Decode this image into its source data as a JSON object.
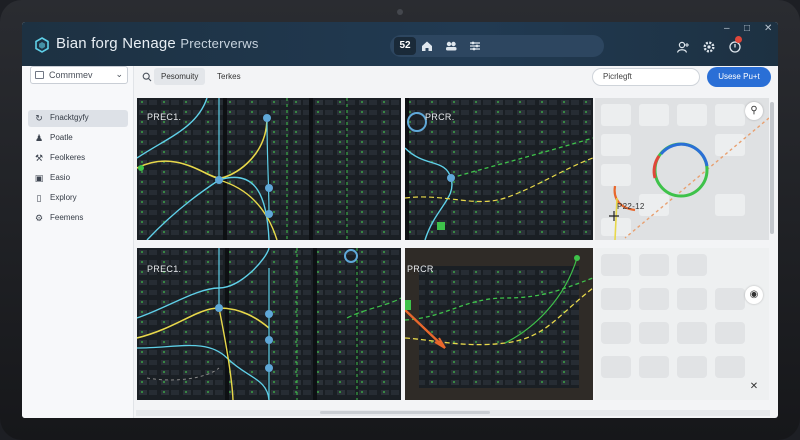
{
  "app": {
    "title": "Bian forg Nenage",
    "subtitle": "Precterverws",
    "pill_badge": "52",
    "colors": {
      "titlebar": "#213a52",
      "accent": "#2a6fd6",
      "cyan": "#5fd0e8",
      "yellow": "#e8d84a",
      "green": "#3ec24a",
      "orange": "#e8672c"
    }
  },
  "window_controls": [
    "minimize",
    "maximize",
    "close"
  ],
  "header_icons": [
    "user-icon",
    "gear-icon",
    "notification-icon"
  ],
  "sidebar": {
    "select_label": "Commmev",
    "items": [
      {
        "label": "Fnacktgyfy",
        "icon": "reload-icon",
        "active": true
      },
      {
        "label": "Poatle",
        "icon": "users-icon",
        "active": false
      },
      {
        "label": "Feolkeres",
        "icon": "tools-icon",
        "active": false
      },
      {
        "label": "Easio",
        "icon": "window-icon",
        "active": false
      },
      {
        "label": "Explory",
        "icon": "bell-icon",
        "active": false
      },
      {
        "label": "Feemens",
        "icon": "gear-icon",
        "active": false
      }
    ]
  },
  "toolbar": {
    "tabs": [
      "Pesomuity",
      "Terkes"
    ],
    "search_value": "Picrlegft",
    "primary_button": "Usese Pu+t"
  },
  "panels": {
    "p1_label": "PREC1.",
    "p2_label": "PRCR.",
    "p3_label": "PREC1.",
    "p4_label": "PRCR",
    "map_label": "P22-12"
  }
}
